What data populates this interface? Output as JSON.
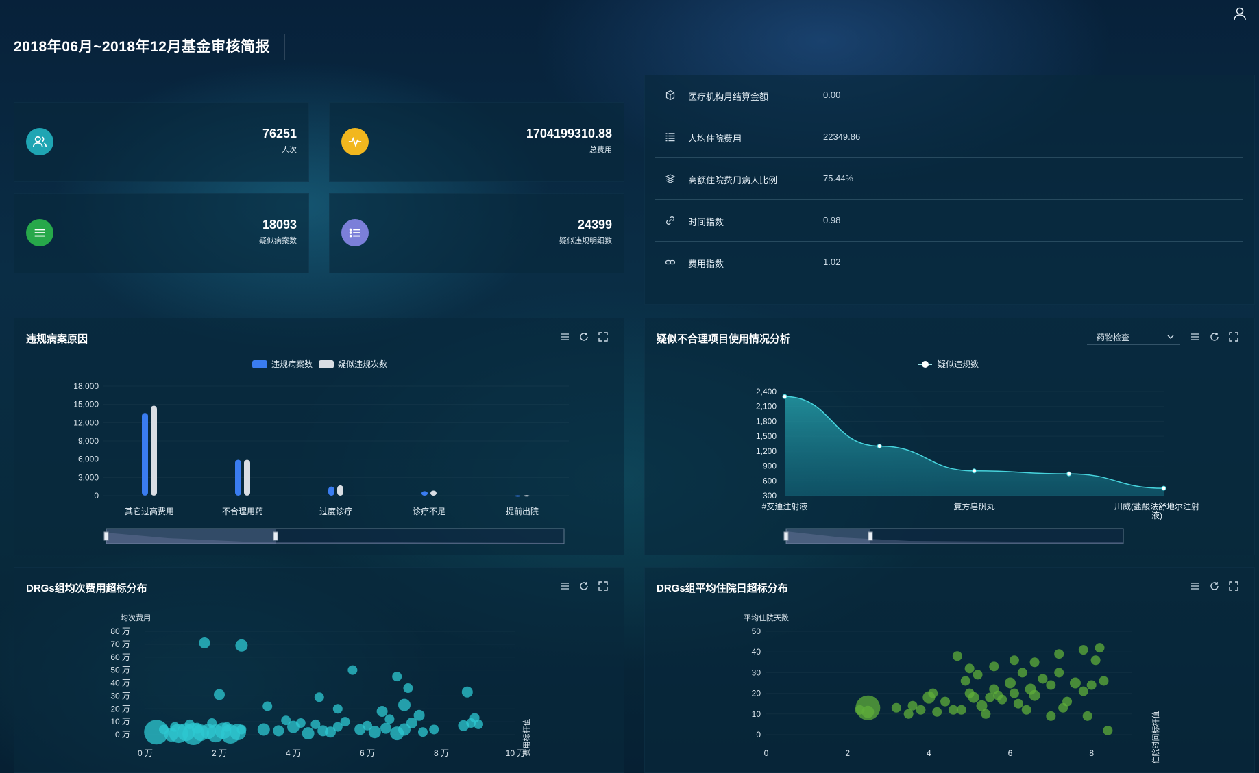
{
  "header": {
    "title": "2018年06月~2018年12月基金审核简报"
  },
  "stats": [
    {
      "value": "76251",
      "label": "人次",
      "icon": "users-icon",
      "color": "#1fa5b3"
    },
    {
      "value": "1704199310.88",
      "label": "总费用",
      "icon": "pulse-icon",
      "color": "#f2b71e"
    },
    {
      "value": "18093",
      "label": "疑似病案数",
      "icon": "menu-icon",
      "color": "#27a84a"
    },
    {
      "value": "24399",
      "label": "疑似违规明细数",
      "icon": "list-icon",
      "color": "#7b7fd9"
    }
  ],
  "info": [
    {
      "label": "医疗机构月结算金额",
      "value": "0.00",
      "icon": "cube-icon"
    },
    {
      "label": "人均住院费用",
      "value": "22349.86",
      "icon": "list-icon"
    },
    {
      "label": "高额住院费用病人比例",
      "value": "75.44%",
      "icon": "layers-icon"
    },
    {
      "label": "时间指数",
      "value": "0.98",
      "icon": "link-icon"
    },
    {
      "label": "费用指数",
      "value": "1.02",
      "icon": "chain-icon"
    }
  ],
  "panels": {
    "violation_reasons": {
      "title": "违规病案原因"
    },
    "unreasonable_items": {
      "title": "疑似不合理项目使用情况分析",
      "select_value": "药物检查"
    },
    "drg_cost": {
      "title": "DRGs组均次费用超标分布"
    },
    "drg_days": {
      "title": "DRGs组平均住院日超标分布"
    }
  },
  "chart_data": [
    {
      "type": "bar",
      "title": "违规病案原因",
      "categories": [
        "其它过高费用",
        "不合理用药",
        "过度诊疗",
        "诊疗不足",
        "提前出院"
      ],
      "series": [
        {
          "name": "违规病案数",
          "values": [
            13600,
            5900,
            1500,
            750,
            60
          ],
          "color": "#3a7cf0"
        },
        {
          "name": "疑似违规次数",
          "values": [
            14800,
            5900,
            1700,
            850,
            80
          ],
          "color": "#d9dde3"
        }
      ],
      "ylim": [
        0,
        18000
      ],
      "yticks": [
        "0",
        "3,000",
        "6,000",
        "9,000",
        "12,000",
        "15,000",
        "18,000"
      ],
      "legend": "top-center",
      "zoom_range": [
        0,
        0.37
      ]
    },
    {
      "type": "area",
      "title": "疑似不合理项目使用情况分析",
      "series": [
        {
          "name": "疑似违规数",
          "values": [
            2300,
            1300,
            800,
            740,
            450
          ]
        }
      ],
      "categories_shown": [
        "#艾迪注射液",
        "复方皂矾丸",
        "川威(盐酸法舒地尔注射液)"
      ],
      "ylim": [
        300,
        2400
      ],
      "yticks": [
        "300",
        "600",
        "900",
        "1,200",
        "1,500",
        "1,800",
        "2,100",
        "2,400"
      ],
      "legend": "top-center",
      "zoom_range": [
        0,
        0.25
      ]
    },
    {
      "type": "scatter",
      "title": "DRGs组均次费用超标分布",
      "ylabel": "均次费用",
      "xlabel": "费用标杆值",
      "xticks": [
        "0 万",
        "2 万",
        "4 万",
        "6 万",
        "8 万",
        "10 万"
      ],
      "yticks": [
        "0 万",
        "10 万",
        "20 万",
        "30 万",
        "40 万",
        "50 万",
        "60 万",
        "70 万",
        "80 万"
      ],
      "xlim": [
        0,
        100000
      ],
      "ylim": [
        0,
        800000
      ],
      "points": [
        [
          16000,
          710000,
          8
        ],
        [
          26000,
          690000,
          9
        ],
        [
          20000,
          310000,
          8
        ],
        [
          56000,
          500000,
          7
        ],
        [
          68000,
          450000,
          7
        ],
        [
          71000,
          360000,
          7
        ],
        [
          87000,
          330000,
          8
        ],
        [
          33000,
          220000,
          7
        ],
        [
          47000,
          290000,
          7
        ],
        [
          52000,
          200000,
          7
        ],
        [
          64000,
          180000,
          8
        ],
        [
          70000,
          230000,
          9
        ],
        [
          74000,
          150000,
          8
        ],
        [
          89000,
          130000,
          7
        ],
        [
          90000,
          80000,
          7
        ],
        [
          3000,
          20000,
          18
        ],
        [
          7000,
          0,
          10
        ],
        [
          9000,
          10000,
          14
        ],
        [
          11000,
          20000,
          13
        ],
        [
          13000,
          5000,
          16
        ],
        [
          15000,
          15000,
          12
        ],
        [
          17000,
          25000,
          11
        ],
        [
          19000,
          10000,
          13
        ],
        [
          21000,
          30000,
          12
        ],
        [
          23000,
          5000,
          14
        ],
        [
          25000,
          20000,
          12
        ],
        [
          5000,
          40000,
          7
        ],
        [
          8000,
          60000,
          7
        ],
        [
          12000,
          80000,
          7
        ],
        [
          14000,
          50000,
          8
        ],
        [
          18000,
          90000,
          7
        ],
        [
          22000,
          60000,
          7
        ],
        [
          26000,
          40000,
          7
        ],
        [
          32000,
          40000,
          9
        ],
        [
          36000,
          30000,
          8
        ],
        [
          40000,
          60000,
          9
        ],
        [
          44000,
          10000,
          9
        ],
        [
          46000,
          80000,
          7
        ],
        [
          48000,
          30000,
          8
        ],
        [
          50000,
          20000,
          8
        ],
        [
          52000,
          60000,
          7
        ],
        [
          58000,
          40000,
          8
        ],
        [
          60000,
          70000,
          7
        ],
        [
          62000,
          20000,
          9
        ],
        [
          65000,
          50000,
          8
        ],
        [
          68000,
          10000,
          10
        ],
        [
          70000,
          40000,
          9
        ],
        [
          72000,
          90000,
          8
        ],
        [
          75000,
          20000,
          7
        ],
        [
          38000,
          110000,
          7
        ],
        [
          42000,
          90000,
          7
        ],
        [
          54000,
          100000,
          7
        ],
        [
          66000,
          120000,
          7
        ],
        [
          78000,
          40000,
          7
        ],
        [
          86000,
          70000,
          8
        ],
        [
          88000,
          90000,
          7
        ]
      ]
    },
    {
      "type": "scatter",
      "title": "DRGs组平均住院日超标分布",
      "ylabel": "平均住院天数",
      "xlabel": "住院时间标杆值",
      "xticks": [
        "0",
        "2",
        "4",
        "6",
        "8"
      ],
      "yticks": [
        "0",
        "10",
        "20",
        "30",
        "40",
        "50"
      ],
      "xlim": [
        0,
        9
      ],
      "ylim": [
        0,
        50
      ],
      "points": [
        [
          2.5,
          13,
          18
        ],
        [
          2.5,
          11,
          9
        ],
        [
          2.3,
          12,
          7
        ],
        [
          3.2,
          13,
          7
        ],
        [
          3.6,
          14,
          7
        ],
        [
          3.8,
          12,
          7
        ],
        [
          4.0,
          18,
          9
        ],
        [
          4.1,
          20,
          7
        ],
        [
          4.4,
          16,
          7
        ],
        [
          4.6,
          12,
          7
        ],
        [
          4.8,
          12,
          7
        ],
        [
          5.0,
          20,
          7
        ],
        [
          5.1,
          18,
          8
        ],
        [
          5.3,
          14,
          8
        ],
        [
          5.5,
          18,
          7
        ],
        [
          5.6,
          22,
          7
        ],
        [
          5.8,
          17,
          7
        ],
        [
          6.0,
          25,
          8
        ],
        [
          6.1,
          20,
          7
        ],
        [
          6.2,
          15,
          7
        ],
        [
          6.3,
          30,
          7
        ],
        [
          6.5,
          22,
          8
        ],
        [
          6.6,
          19,
          8
        ],
        [
          6.8,
          27,
          7
        ],
        [
          7.0,
          24,
          7
        ],
        [
          7.2,
          30,
          7
        ],
        [
          7.4,
          16,
          7
        ],
        [
          7.6,
          25,
          8
        ],
        [
          7.8,
          21,
          7
        ],
        [
          8.0,
          24,
          7
        ],
        [
          4.9,
          26,
          7
        ],
        [
          5.2,
          29,
          7
        ],
        [
          5.6,
          33,
          7
        ],
        [
          6.1,
          36,
          7
        ],
        [
          6.6,
          35,
          7
        ],
        [
          7.2,
          39,
          7
        ],
        [
          7.8,
          41,
          7
        ],
        [
          8.1,
          36,
          7
        ],
        [
          8.2,
          42,
          7
        ],
        [
          4.7,
          38,
          7
        ],
        [
          5.0,
          32,
          7
        ],
        [
          6.4,
          12,
          7
        ],
        [
          7.0,
          9,
          7
        ],
        [
          7.3,
          13,
          7
        ],
        [
          7.9,
          9,
          7
        ],
        [
          8.3,
          26,
          7
        ],
        [
          8.4,
          2,
          7
        ],
        [
          5.7,
          19,
          7
        ],
        [
          5.4,
          10,
          7
        ],
        [
          4.2,
          11,
          7
        ],
        [
          3.5,
          10,
          7
        ]
      ]
    }
  ]
}
